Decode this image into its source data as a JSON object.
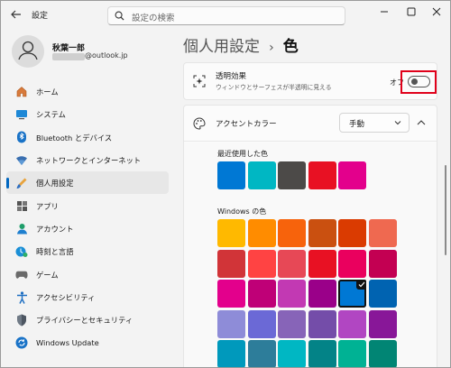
{
  "app": {
    "title": "設定"
  },
  "search": {
    "placeholder": "設定の検索"
  },
  "profile": {
    "name": "秋葉一郎",
    "email": "@outlook.jp"
  },
  "sidebar": {
    "items": [
      {
        "label": "ホーム",
        "icon": "home-icon"
      },
      {
        "label": "システム",
        "icon": "system-icon"
      },
      {
        "label": "Bluetooth とデバイス",
        "icon": "bluetooth-icon"
      },
      {
        "label": "ネットワークとインターネット",
        "icon": "network-icon"
      },
      {
        "label": "個人用設定",
        "icon": "personalization-icon",
        "selected": true
      },
      {
        "label": "アプリ",
        "icon": "apps-icon"
      },
      {
        "label": "アカウント",
        "icon": "account-icon"
      },
      {
        "label": "時刻と言語",
        "icon": "time-language-icon"
      },
      {
        "label": "ゲーム",
        "icon": "gaming-icon"
      },
      {
        "label": "アクセシビリティ",
        "icon": "accessibility-icon"
      },
      {
        "label": "プライバシーとセキュリティ",
        "icon": "privacy-icon"
      },
      {
        "label": "Windows Update",
        "icon": "windows-update-icon"
      }
    ]
  },
  "breadcrumb": {
    "parent": "個人用設定",
    "separator": "›",
    "current": "色"
  },
  "transparency": {
    "title": "透明効果",
    "description": "ウィンドウとサーフェスが半透明に見える",
    "state": "オフ"
  },
  "accent": {
    "title": "アクセントカラー",
    "mode": "手動",
    "recent_label": "最近使用した色",
    "recent_colors": [
      "#0078d4",
      "#00b7c3",
      "#4c4a48",
      "#e81123",
      "#e3008c"
    ],
    "windows_label": "Windows の色",
    "windows_colors": [
      [
        "#ffb900",
        "#ff8c00",
        "#f7630c",
        "#ca5010",
        "#da3b01",
        "#ef6950"
      ],
      [
        "#d13438",
        "#ff4343",
        "#e74856",
        "#e81123",
        "#ea005e",
        "#c30052"
      ],
      [
        "#e3008c",
        "#bf0077",
        "#c239b3",
        "#9a0089",
        "#0078d4",
        "#0063b1"
      ],
      [
        "#8e8cd8",
        "#6b69d6",
        "#8764b8",
        "#744da9",
        "#b146c2",
        "#881798"
      ],
      [
        "#0099bc",
        "#2d7d9a",
        "#00b7c3",
        "#038387",
        "#00b294",
        "#018574"
      ]
    ],
    "selected_color": "#0078d4"
  }
}
